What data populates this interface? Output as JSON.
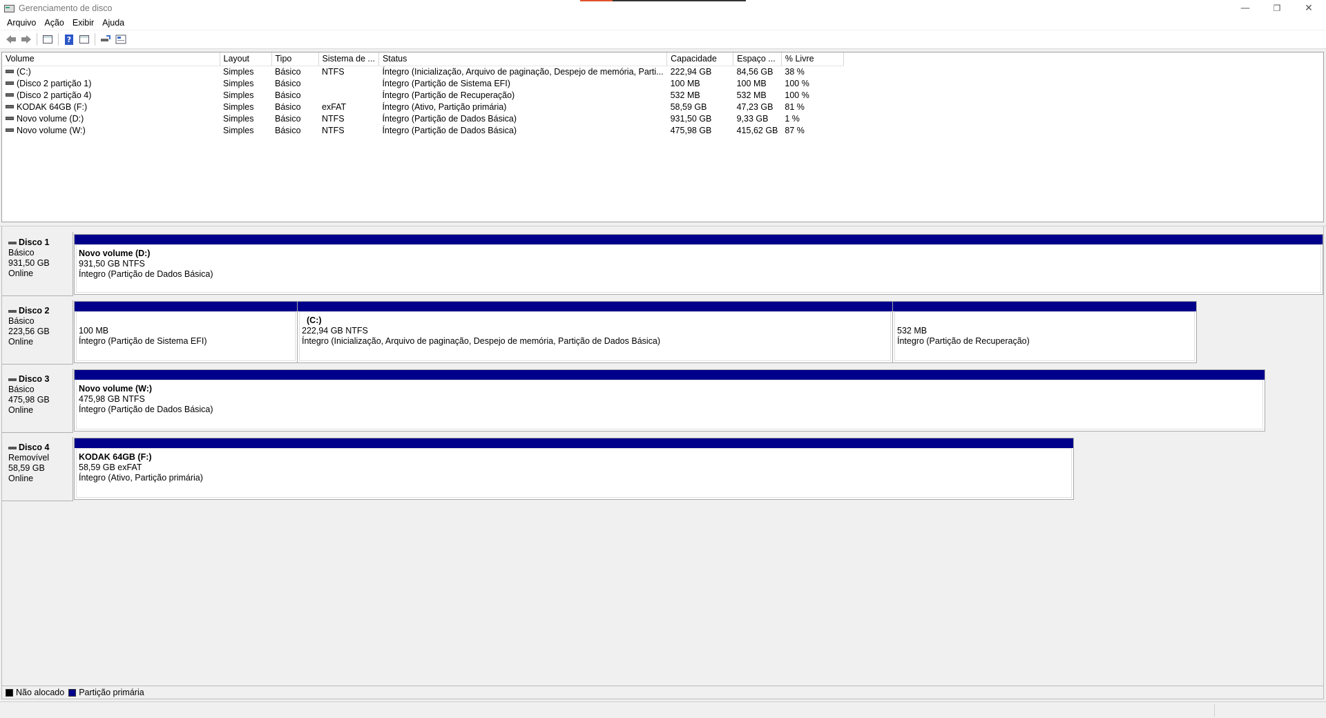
{
  "window": {
    "title": "Gerenciamento de disco",
    "controls": {
      "minimize": "—",
      "restore": "❐",
      "close": "✕"
    }
  },
  "menu": [
    "Arquivo",
    "Ação",
    "Exibir",
    "Ajuda"
  ],
  "toolbar": {
    "icons": [
      "back-arrow-icon",
      "forward-arrow-icon",
      "console-tree-icon",
      "help-icon",
      "properties-icon",
      "rescan-icon",
      "disk-list-icon"
    ],
    "help_glyph": "?"
  },
  "volume_table": {
    "columns": [
      "Volume",
      "Layout",
      "Tipo",
      "Sistema de ...",
      "Status",
      "Capacidade",
      "Espaço ...",
      "% Livre"
    ],
    "rows": [
      [
        "(C:)",
        "Simples",
        "Básico",
        "NTFS",
        "Íntegro (Inicialização, Arquivo de paginação, Despejo de memória, Parti...",
        "222,94 GB",
        "84,56 GB",
        "38 %"
      ],
      [
        "(Disco 2 partição 1)",
        "Simples",
        "Básico",
        "",
        "Íntegro (Partição de Sistema EFI)",
        "100 MB",
        "100 MB",
        "100 %"
      ],
      [
        "(Disco 2 partição 4)",
        "Simples",
        "Básico",
        "",
        "Íntegro (Partição de Recuperação)",
        "532 MB",
        "532 MB",
        "100 %"
      ],
      [
        "KODAK 64GB (F:)",
        "Simples",
        "Básico",
        "exFAT",
        "Íntegro (Ativo, Partição primária)",
        "58,59 GB",
        "47,23 GB",
        "81 %"
      ],
      [
        "Novo volume (D:)",
        "Simples",
        "Básico",
        "NTFS",
        "Íntegro (Partição de Dados Básica)",
        "931,50 GB",
        "9,33 GB",
        "1 %"
      ],
      [
        "Novo volume (W:)",
        "Simples",
        "Básico",
        "NTFS",
        "Íntegro (Partição de Dados Básica)",
        "475,98 GB",
        "415,62 GB",
        "87 %"
      ]
    ]
  },
  "disks": [
    {
      "name": "Disco 1",
      "type": "Básico",
      "size": "931,50 GB",
      "state": "Online",
      "partitions": [
        {
          "name": "Novo volume  (D:)",
          "size": "931,50 GB NTFS",
          "status": "Íntegro (Partição de Dados Básica)"
        }
      ]
    },
    {
      "name": "Disco 2",
      "type": "Básico",
      "size": "223,56 GB",
      "state": "Online",
      "partitions": [
        {
          "name": "",
          "size": "100 MB",
          "status": "Íntegro (Partição de Sistema EFI)"
        },
        {
          "name": "(C:)",
          "size": "222,94 GB NTFS",
          "status": "Íntegro (Inicialização, Arquivo de paginação, Despejo de memória, Partição de Dados Básica)"
        },
        {
          "name": "",
          "size": "532 MB",
          "status": "Íntegro (Partição de Recuperação)"
        }
      ]
    },
    {
      "name": "Disco 3",
      "type": "Básico",
      "size": "475,98 GB",
      "state": "Online",
      "partitions": [
        {
          "name": "Novo volume  (W:)",
          "size": "475,98 GB NTFS",
          "status": "Íntegro (Partição de Dados Básica)"
        }
      ]
    },
    {
      "name": "Disco 4",
      "type": "Removível",
      "size": "58,59 GB",
      "state": "Online",
      "partitions": [
        {
          "name": "KODAK 64GB  (F:)",
          "size": "58,59 GB exFAT",
          "status": "Íntegro (Ativo, Partição primária)"
        }
      ]
    }
  ],
  "legend": [
    {
      "label": "Não alocado",
      "color": "#000000"
    },
    {
      "label": "Partição primária",
      "color": "#00008b"
    }
  ]
}
